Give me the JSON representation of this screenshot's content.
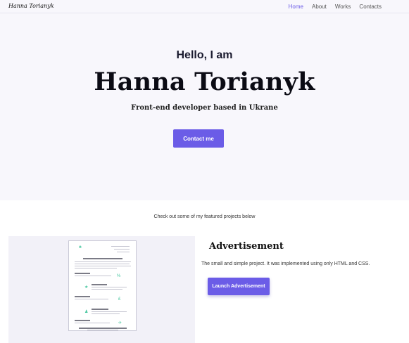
{
  "nav": {
    "logo": "Hanna Torianyk",
    "links": [
      {
        "label": "Home",
        "active": true
      },
      {
        "label": "About",
        "active": false
      },
      {
        "label": "Works",
        "active": false
      },
      {
        "label": "Contacts",
        "active": false
      }
    ]
  },
  "hero": {
    "greeting": "Hello, I am",
    "name": "Hanna Torianyk",
    "tagline": "Front-end developer based in Ukrane",
    "cta_label": "Contact me"
  },
  "featured": {
    "intro": "Check out some of my featured projects below"
  },
  "project": {
    "title": "Advertisement",
    "description": "The small and simple project. It was implemented using only HTML and CSS.",
    "button_label": "Launch Advertisement"
  },
  "colors": {
    "accent": "#6b5ce7",
    "hero_bg": "#f8f7fc",
    "preview_bg": "#f2f1f8"
  }
}
